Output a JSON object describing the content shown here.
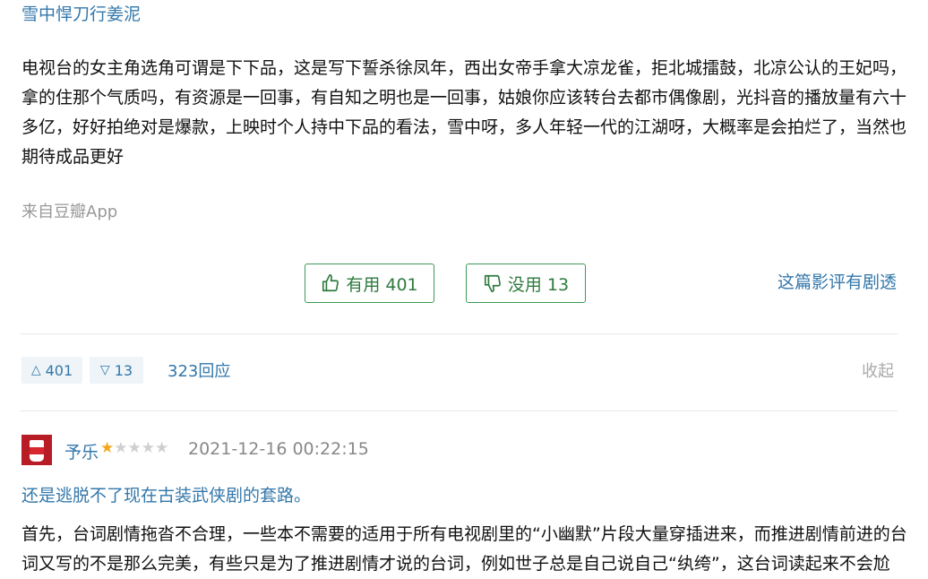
{
  "review": {
    "title": "雪中悍刀行姜泥",
    "body": "电视台的女主角选角可谓是下下品，这是写下誓杀徐凤年，西出女帝手拿大凉龙雀，拒北城擂鼓，北凉公认的王妃吗，拿的住那个气质吗，有资源是一回事，有自知之明也是一回事，姑娘你应该转台去都市偶像剧，光抖音的播放量有六十多亿，好好拍绝对是爆款，上映时个人持中下品的看法，雪中呀，多人年轻一代的江湖呀，大概率是会拍烂了，当然也期待成品更好",
    "source": "来自豆瓣App"
  },
  "votes": {
    "useful_label": "有用 401",
    "useless_label": "没用 13",
    "spoiler_link": "这篇影评有剧透"
  },
  "stats": {
    "up_count": "401",
    "down_count": "13",
    "replies": "323回应",
    "collapse": "收起"
  },
  "comment": {
    "username": "予乐",
    "rating": 1,
    "rating_max": 5,
    "timestamp": "2021-12-16 00:22:15",
    "title": "还是逃脱不了现在古装武侠剧的套路。",
    "body": "首先，台词剧情拖沓不合理，一些本不需要的适用于所有电视剧里的“小幽默”片段大量穿插进来，而推进剧情前进的台词又写的不是那么完美，有些只是为了推进剧情才说的台词，例如世子总是自己说自己“纨绔”，这台词读起来不会尬"
  },
  "colors": {
    "link": "#3377aa",
    "button_border": "#3c9a55",
    "button_text": "#2e7a3e",
    "star_on": "#f4a61a",
    "chip_bg": "#eef4f8"
  }
}
